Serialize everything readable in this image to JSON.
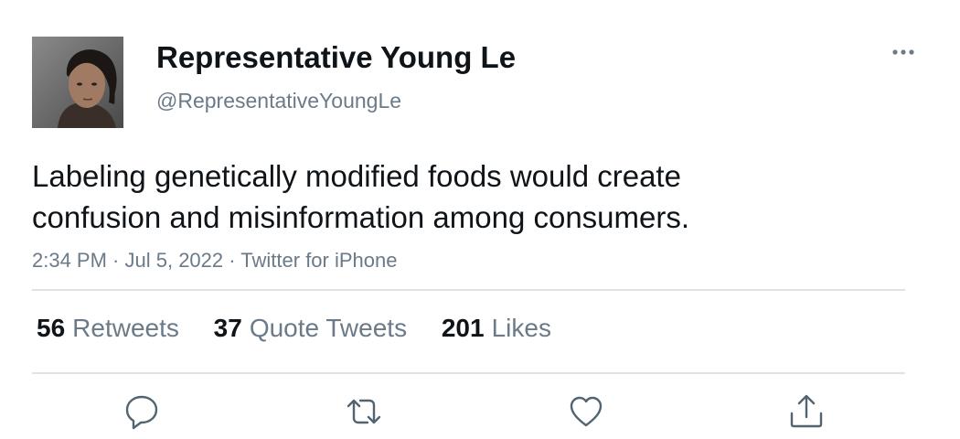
{
  "author": {
    "display_name": "Representative Young Le",
    "handle": "@RepresentativeYoungLe",
    "avatar": "avatar-photo"
  },
  "tweet": {
    "text": "Labeling genetically modified foods would create confusion and misinformation among consumers.",
    "time": "2:34 PM",
    "date": "Jul 5, 2022",
    "source": "Twitter for iPhone",
    "separator": " · "
  },
  "stats": {
    "retweets": {
      "count": "56",
      "label": "Retweets"
    },
    "quote_tweets": {
      "count": "37",
      "label": "Quote Tweets"
    },
    "likes": {
      "count": "201",
      "label": "Likes"
    }
  },
  "actions": [
    {
      "name": "reply",
      "icon": "speech-bubble-icon"
    },
    {
      "name": "retweet",
      "icon": "retweet-arrows-icon"
    },
    {
      "name": "like",
      "icon": "heart-icon"
    },
    {
      "name": "share",
      "icon": "share-upload-icon"
    }
  ],
  "colors": {
    "text_primary": "#0f1419",
    "text_secondary": "#6b7a89",
    "divider": "#dfe3e6",
    "icon": "#536471"
  }
}
